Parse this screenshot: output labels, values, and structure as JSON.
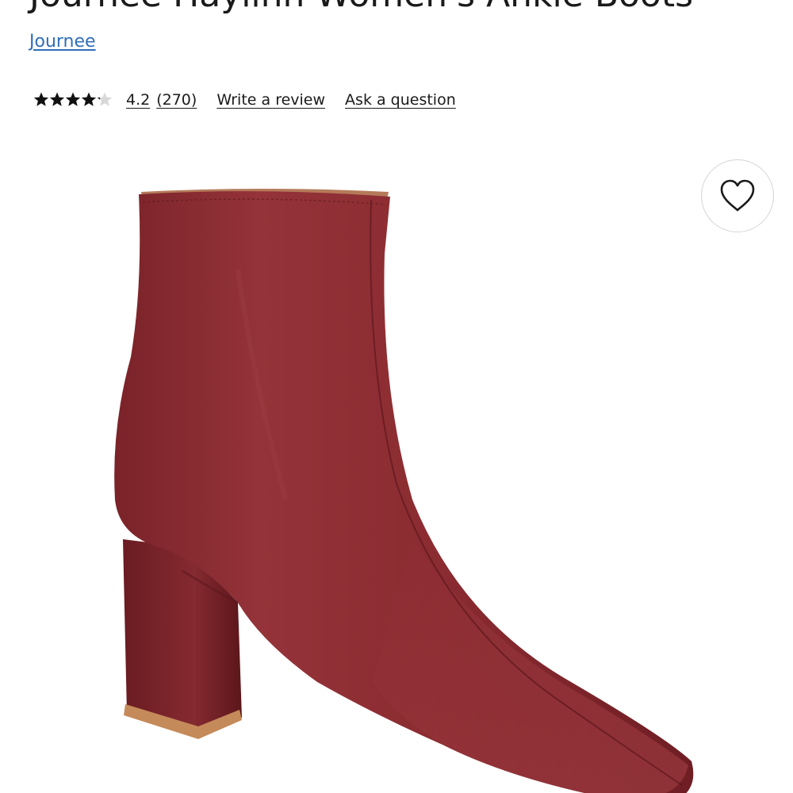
{
  "product": {
    "title": "Journee Haylinn Women's Ankle Boots",
    "brand": "Journee",
    "image_description_icon": "boot-product-image"
  },
  "rating": {
    "value": 4.2,
    "max": 5,
    "average_text": "4.2",
    "count_text": "(270)"
  },
  "actions": {
    "write_review": "Write a review",
    "ask_question": "Ask a question"
  },
  "icons": {
    "wishlist": "heart-icon",
    "star": "star-icon"
  },
  "colors": {
    "brand_link": "#2f6eba",
    "text": "#1a1a1a",
    "boot": "#8b2c31",
    "star_filled": "#111111",
    "star_empty": "#d8d8d8"
  }
}
